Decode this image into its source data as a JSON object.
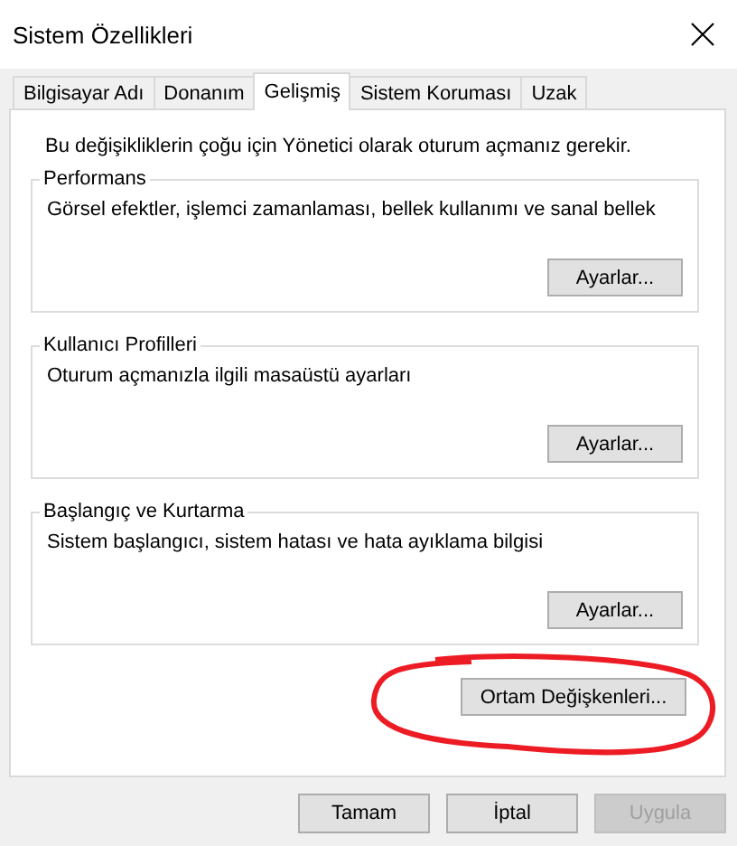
{
  "window": {
    "title": "Sistem Özellikleri"
  },
  "tabs": [
    {
      "label": "Bilgisayar Adı",
      "selected": false
    },
    {
      "label": "Donanım",
      "selected": false
    },
    {
      "label": "Gelişmiş",
      "selected": true
    },
    {
      "label": "Sistem Koruması",
      "selected": false
    },
    {
      "label": "Uzak",
      "selected": false
    }
  ],
  "intro": "Bu değişikliklerin çoğu için Yönetici olarak oturum açmanız gerekir.",
  "groups": [
    {
      "title": "Performans",
      "description": "Görsel efektler, işlemci zamanlaması, bellek kullanımı ve sanal bellek",
      "button": "Ayarlar..."
    },
    {
      "title": "Kullanıcı Profilleri",
      "description": "Oturum açmanızla ilgili masaüstü ayarları",
      "button": "Ayarlar..."
    },
    {
      "title": "Başlangıç ve Kurtarma",
      "description": "Sistem başlangıcı, sistem hatası ve hata ayıklama bilgisi",
      "button": "Ayarlar..."
    }
  ],
  "environment_button": {
    "label": "Ortam Değişkenleri...",
    "circled": true
  },
  "buttons": [
    {
      "label": "Tamam",
      "disabled": false
    },
    {
      "label": "İptal",
      "disabled": false
    },
    {
      "label": "Uygula",
      "disabled": true
    }
  ]
}
